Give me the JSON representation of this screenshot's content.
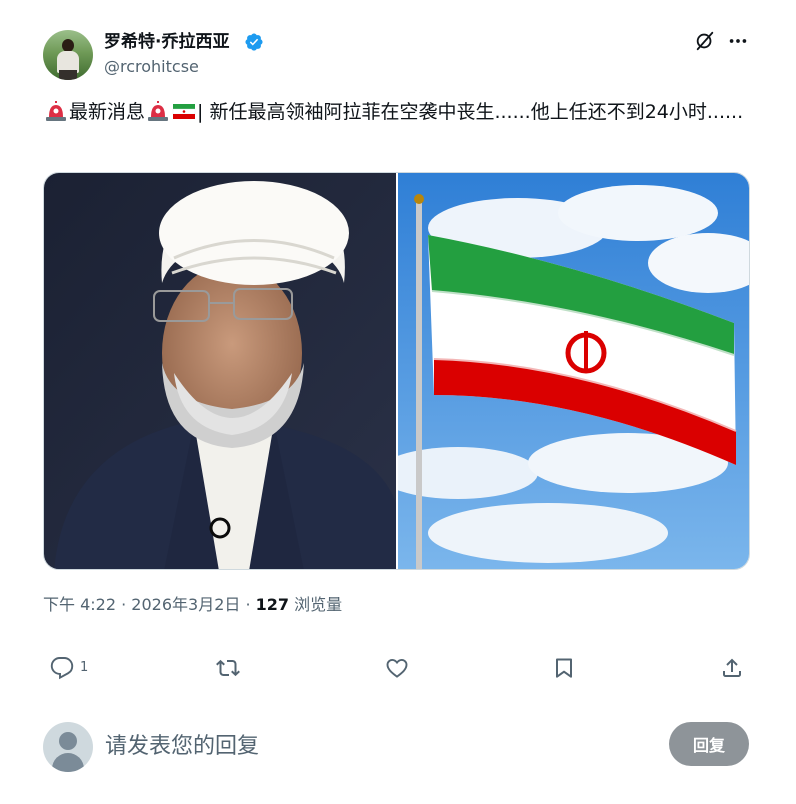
{
  "author": {
    "display_name": "罗希特·乔拉西亚",
    "handle": "@rcrohitcse",
    "verified": true
  },
  "tweet": {
    "text_line": "最新消息",
    "text_body": "| 新任最高领袖阿拉菲在空袭中丧生......他上任还不到24小时......",
    "emojis": [
      "rotating-light",
      "rotating-light",
      "iran-flag"
    ]
  },
  "media": {
    "images": [
      "cleric-portrait-photo",
      "iran-flag-photo"
    ]
  },
  "meta": {
    "time": "下午 4:22",
    "sep1": " · ",
    "date": "2026年3月2日",
    "sep2": " · ",
    "views_count": "127",
    "views_label": " 浏览量"
  },
  "actions": {
    "reply_count": "1"
  },
  "reply_box": {
    "placeholder": "请发表您的回复",
    "button_label": "回复"
  },
  "colors": {
    "text_primary": "#0f1419",
    "text_secondary": "#536471",
    "verified_blue": "#1d9bf0",
    "reply_button_bg": "#8e9499"
  },
  "icons": {
    "verified": "verified-badge-icon",
    "grok": "grok-icon",
    "more": "more-icon",
    "reply": "reply-icon",
    "retweet": "retweet-icon",
    "like": "heart-icon",
    "bookmark": "bookmark-icon",
    "share": "share-icon"
  }
}
